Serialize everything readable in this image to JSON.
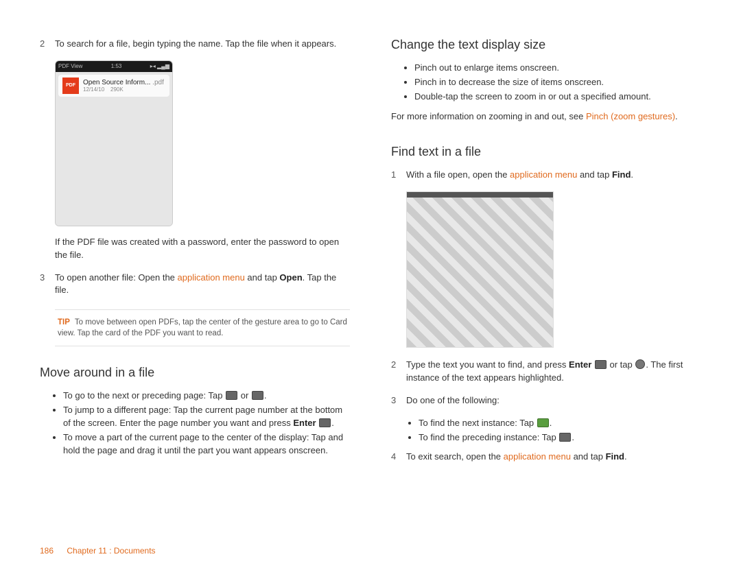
{
  "left": {
    "step2": "To search for a file, begin typing the name. Tap the file when it appears.",
    "phone": {
      "app": "PDF View",
      "time": "1:53",
      "file_title_a": "Open Source Inform... ",
      "file_title_ext": ".pdf",
      "file_date": "12/14/10",
      "file_size": "290K"
    },
    "password_note": "If the PDF file was created with a password, enter the password to open the file.",
    "step3_a": "To open another file: Open the ",
    "step3_link": "application menu",
    "step3_b": " and tap ",
    "step3_bold": "Open",
    "step3_c": ". Tap the file.",
    "tip_label": "TIP",
    "tip_text": "To move between open PDFs, tap the center of the gesture area to go to Card view. Tap the card of the PDF you want to read.",
    "move_h": "Move around in a file",
    "move1": "To go to the next or preceding page: Tap",
    "move1_or": "or",
    "move1_end": ".",
    "move2_a": "To jump to a different page: Tap the current page number at the bottom of the screen. Enter the page number you want and press ",
    "move2_bold": "Enter",
    "move2_c": ".",
    "move3": "To move a part of the current page to the center of the display: Tap and hold the page and drag it until the part you want appears onscreen."
  },
  "right": {
    "change_h": "Change the text display size",
    "c1": "Pinch out to enlarge items onscreen.",
    "c2": "Pinch in to decrease the size of items onscreen.",
    "c3": "Double-tap the screen to zoom in or out a specified amount.",
    "more_a": "For more information on zooming in and out, see ",
    "more_link": "Pinch (zoom gestures)",
    "more_b": ".",
    "find_h": "Find text in a file",
    "f1_a": "With a file open, open the ",
    "f1_link": "application menu",
    "f1_b": " and tap ",
    "f1_bold": "Find",
    "f1_c": ".",
    "f2_a": "Type the text you want to find, and press ",
    "f2_bold": "Enter",
    "f2_b": " or tap ",
    "f2_c": ". The first instance of the text appears highlighted.",
    "f3": "Do one of the following:",
    "f3a": "To find the next instance: Tap",
    "f3a_end": ".",
    "f3b": "To find the preceding instance: Tap",
    "f3b_end": ".",
    "f4_a": "To exit search, open the ",
    "f4_link": "application menu",
    "f4_b": " and tap ",
    "f4_bold": "Find",
    "f4_c": "."
  },
  "footer": {
    "page": "186",
    "chapter": "Chapter 11 : Documents"
  }
}
